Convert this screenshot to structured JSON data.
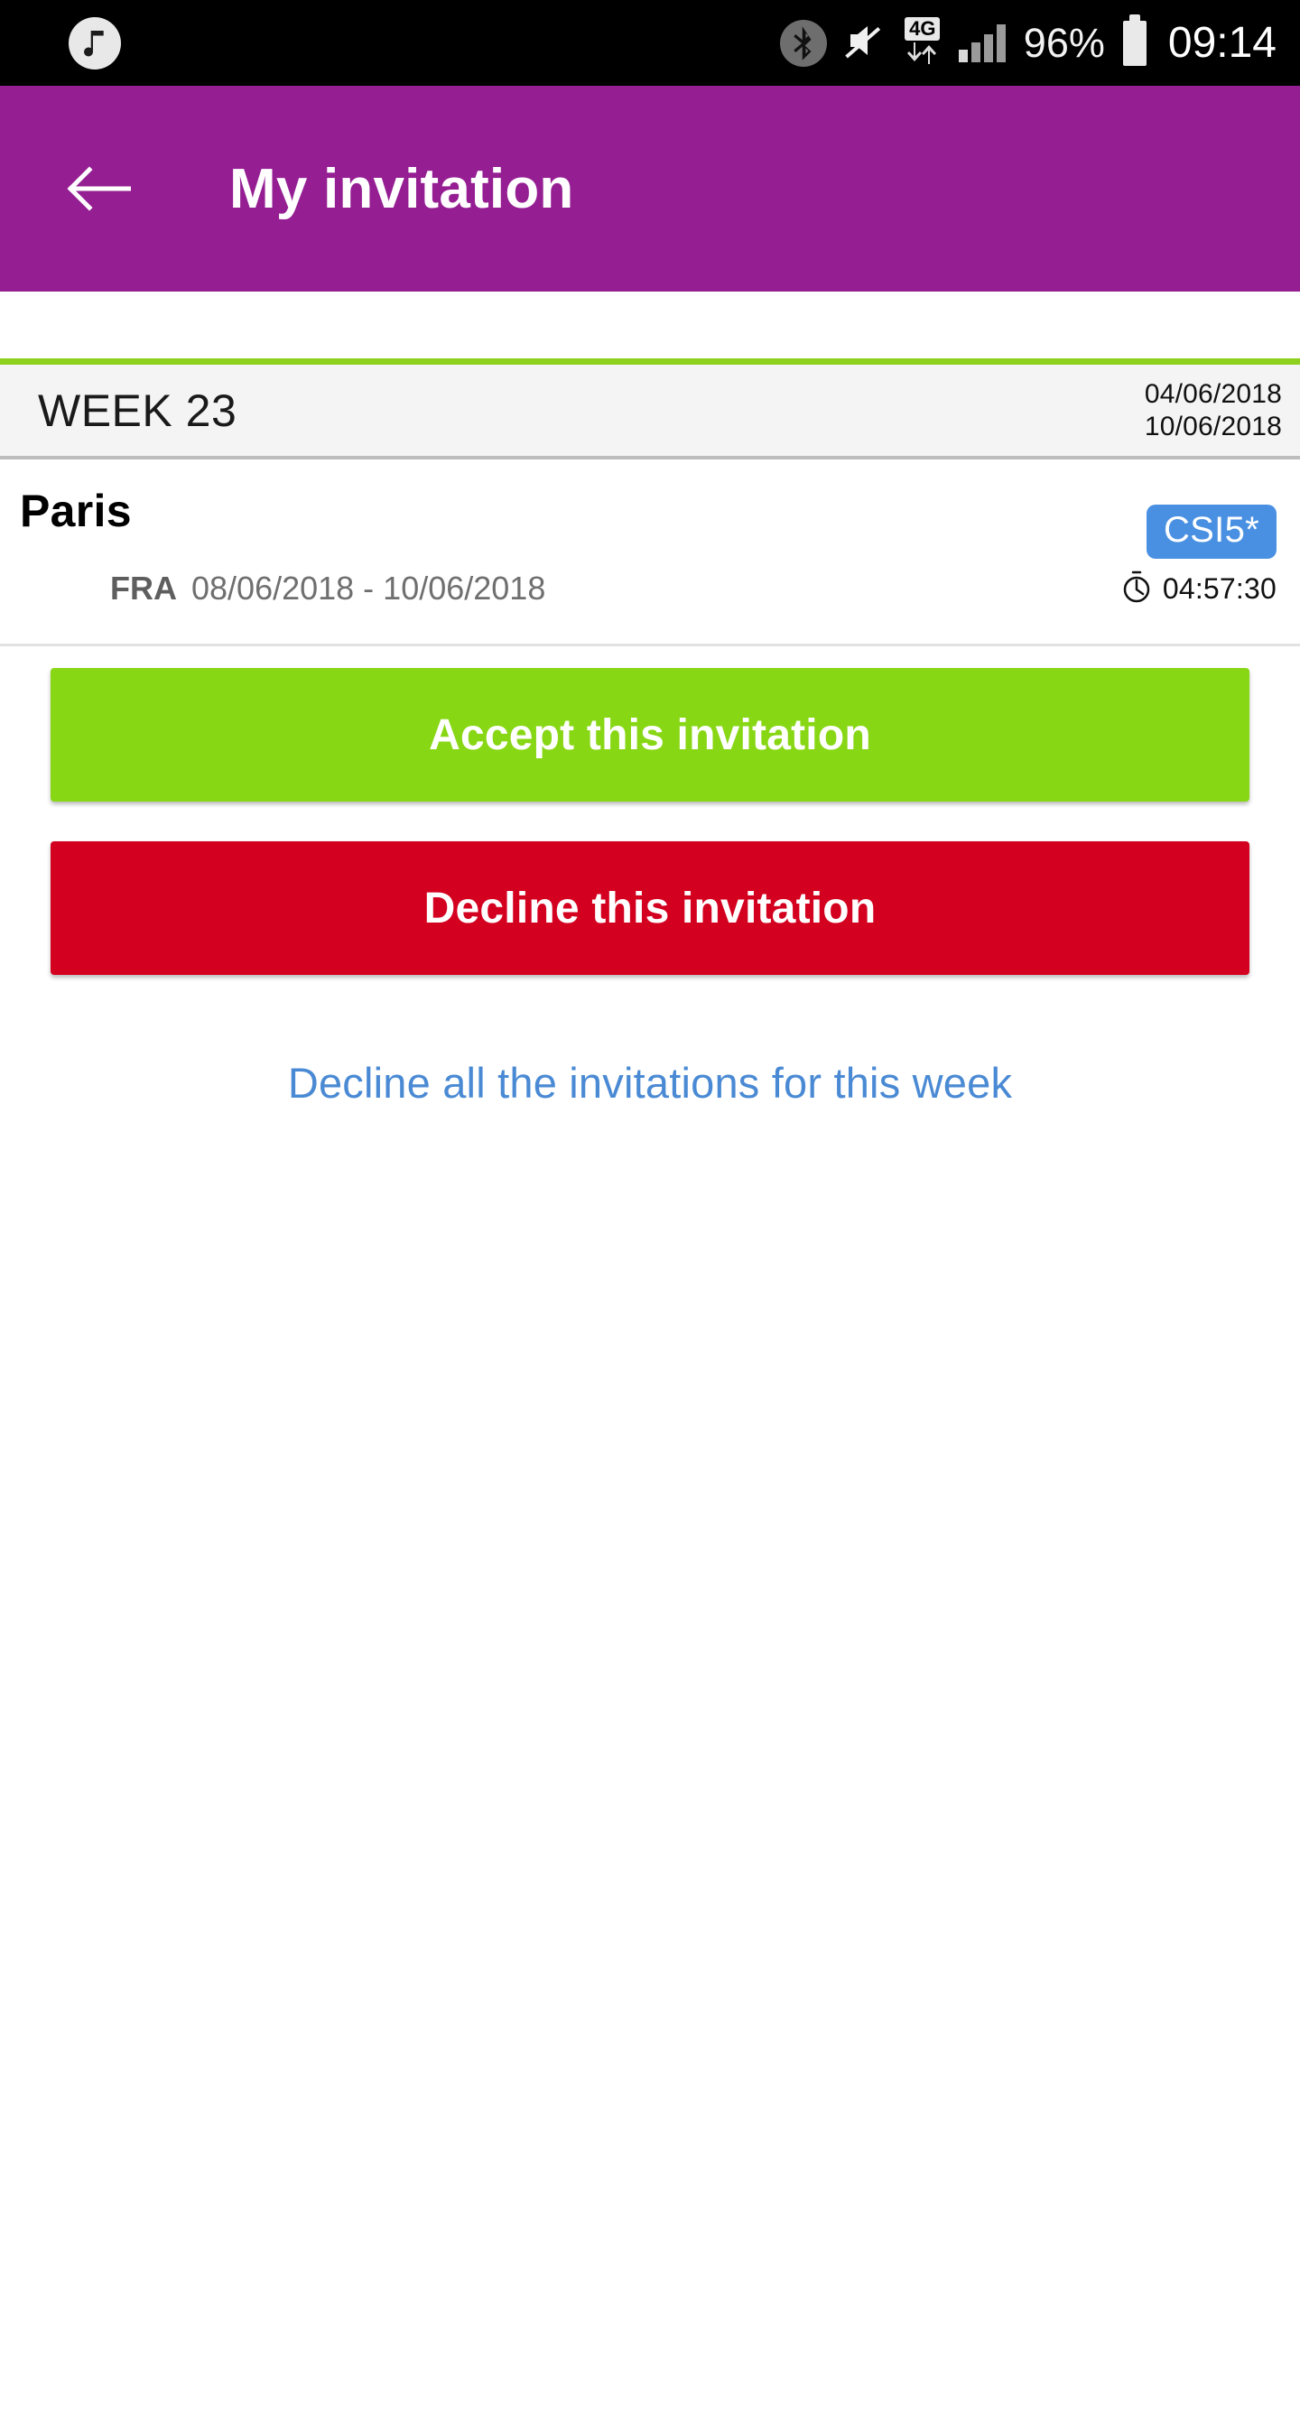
{
  "status_bar": {
    "notification_icon": "music-note-icon",
    "bluetooth_icon": "bluetooth-icon",
    "mute_icon": "volume-muted-icon",
    "network_label": "4G",
    "data_arrows_icon": "data-transfer-icon",
    "signal_icon": "signal-bars-icon",
    "battery_percent": "96%",
    "battery_icon": "battery-icon",
    "clock": "09:14"
  },
  "app_bar": {
    "back_icon": "arrow-left-icon",
    "title": "My invitation"
  },
  "week_header": {
    "title": "WEEK 23",
    "start_date": "04/06/2018",
    "end_date": "10/06/2018"
  },
  "event": {
    "city": "Paris",
    "country_code": "FRA",
    "date_range": "08/06/2018 - 10/06/2018",
    "level_badge": "CSI5*",
    "countdown_icon": "stopwatch-icon",
    "countdown": "04:57:30"
  },
  "actions": {
    "accept_label": "Accept this invitation",
    "decline_label": "Decline this invitation",
    "decline_all_label": "Decline all the invitations for this week"
  },
  "colors": {
    "app_bar": "#951E93",
    "accent_green": "#8ed01e",
    "accept_green": "#88d715",
    "decline_red": "#d4001f",
    "badge_blue": "#4a90e2",
    "link_blue": "#4a8ad4"
  }
}
